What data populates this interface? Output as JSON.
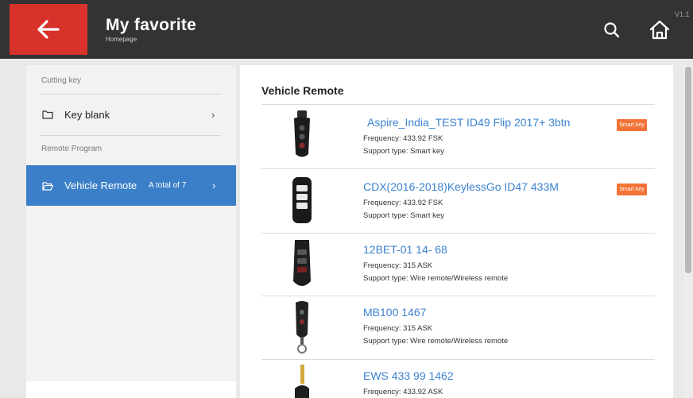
{
  "header": {
    "title": "My favorite",
    "subtitle": "Homepage",
    "version": "V1.1"
  },
  "sidebar": {
    "sections": [
      {
        "label": "Cutting key"
      },
      {
        "label": "Remote Program"
      }
    ],
    "items": [
      {
        "label": "Key blank",
        "icon": "folder-icon"
      },
      {
        "label": "Vehicle Remote",
        "count": "A total of 7",
        "icon": "folder-open-icon",
        "active": true
      }
    ]
  },
  "main": {
    "title": "Vehicle Remote",
    "items": [
      {
        "name": "Aspire_India_TEST ID49 Flip 2017+ 3btn",
        "frequency": "Frequency: 433.92 FSK",
        "support": "Support type: Smart key",
        "badge": "Smart key"
      },
      {
        "name": "CDX(2016-2018)KeylessGo ID47 433M",
        "frequency": "Frequency: 433.92 FSK",
        "support": "Support type: Smart key",
        "badge": "Smart key"
      },
      {
        "name": "12BET-01 14- 68",
        "frequency": "Frequency: 315 ASK",
        "support": "Support type: Wire remote/Wireless remote"
      },
      {
        "name": "MB100 1467",
        "frequency": "Frequency: 315 ASK",
        "support": "Support type: Wire remote/Wireless remote"
      },
      {
        "name": "EWS 433 99 1462",
        "frequency": "Frequency: 433.92 ASK"
      }
    ]
  },
  "colors": {
    "topbar": "#333333",
    "back_button": "#d8322b",
    "active_item": "#3a7fc8",
    "link_text": "#3c82cf",
    "badge": "#f37336"
  }
}
